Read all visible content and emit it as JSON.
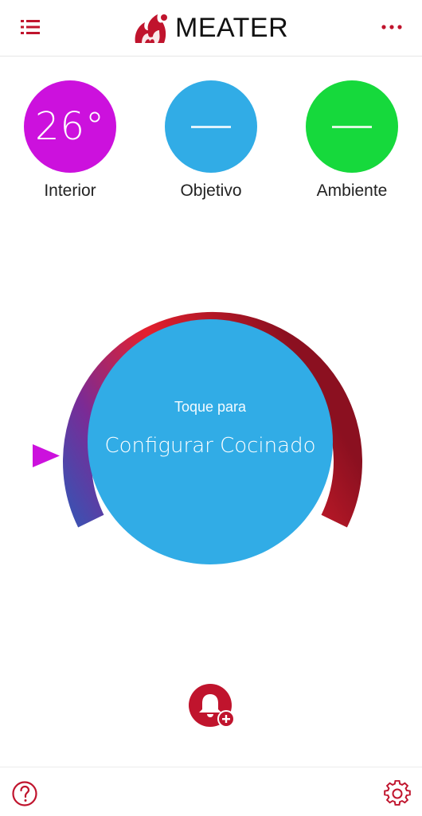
{
  "header": {
    "brand": "MEATER",
    "menu_icon": "list-icon",
    "more_icon": "more-dots-icon",
    "accent_color": "#c0142d"
  },
  "temperatures": [
    {
      "id": "internal",
      "label": "Interior",
      "value": "26°",
      "color": "#cc11dd"
    },
    {
      "id": "target",
      "label": "Objetivo",
      "value": null,
      "color": "#31ace6"
    },
    {
      "id": "ambient",
      "label": "Ambiente",
      "value": null,
      "color": "#16d93c"
    }
  ],
  "dial": {
    "tap_text": "Toque para",
    "action_text": "Configurar Cocinado",
    "center_color": "#31ace6",
    "pointer_color": "#cc11dd",
    "gradient_colors": [
      "#3f4fb0",
      "#8a2a8f",
      "#e4202e",
      "#8b1020"
    ]
  },
  "footer": {
    "help_icon": "help-icon",
    "settings_icon": "gear-icon",
    "alert_icon": "bell-add-icon"
  }
}
